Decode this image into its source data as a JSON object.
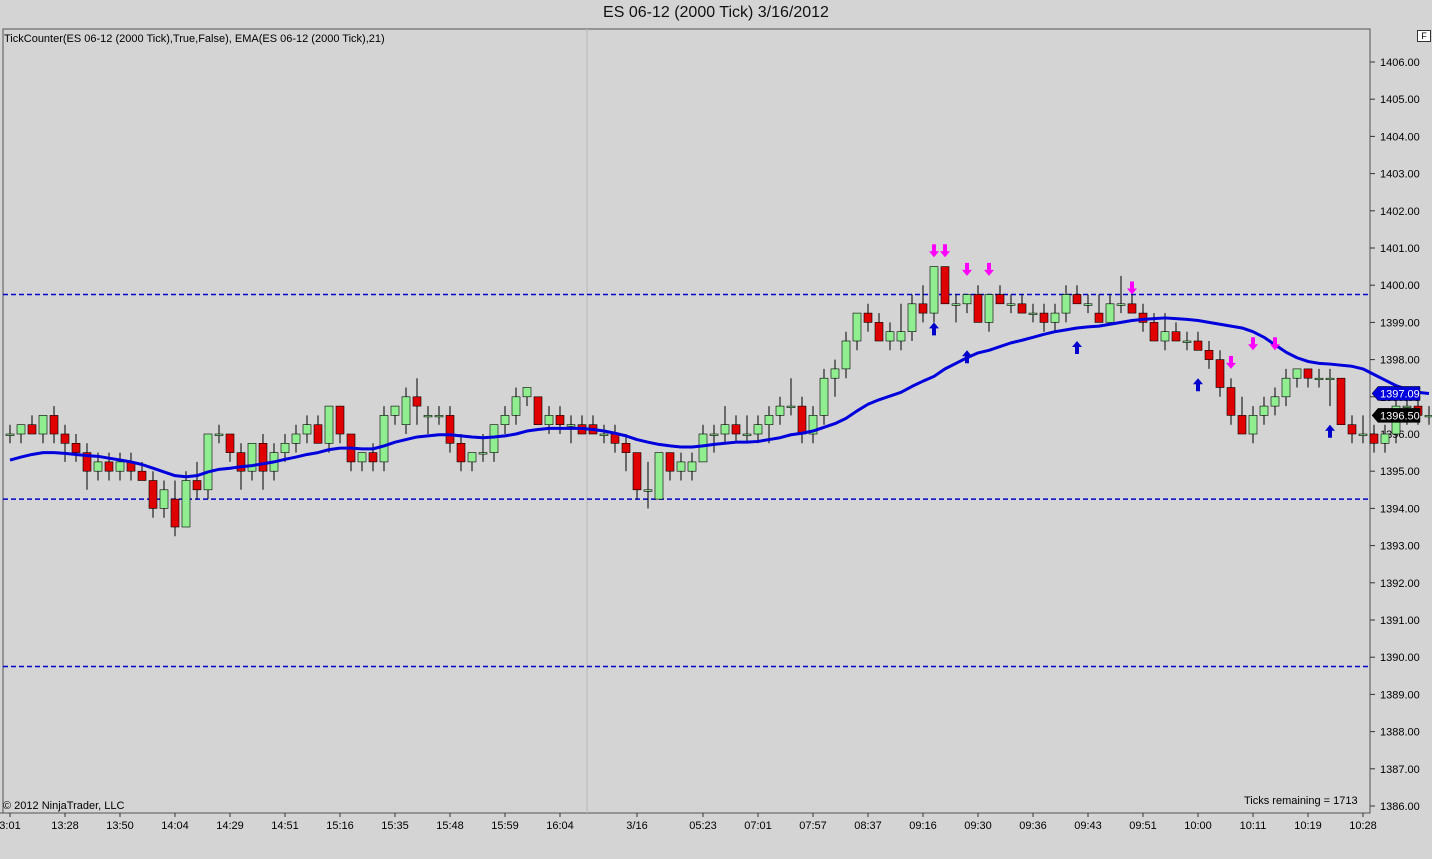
{
  "window": {
    "title": "ES 06-12 (2000 Tick)  3/16/2012"
  },
  "chart": {
    "indicator_label": "TickCounter(ES 06-12 (2000 Tick),True,False), EMA(ES 06-12 (2000 Tick),21)",
    "copyright": "© 2012 NinjaTrader, LLC",
    "ticks_remaining": "Ticks remaining = 1713",
    "f_button": "F",
    "colors": {
      "background": "#d4d4d4",
      "up": "#90ee90",
      "down": "#e00000",
      "ema": "#0000dd",
      "hline": "#0000cc",
      "long_arrow": "#0000cc",
      "short_arrow": "#ff00ff"
    }
  },
  "chart_data": {
    "type": "candlestick",
    "instrument": "ES 06-12",
    "bar_type": "2000 Tick",
    "date": "3/16/2012",
    "y_axis": {
      "min": 1386,
      "max": 1406.4,
      "tick_labels": [
        "1406.00",
        "1405.00",
        "1404.00",
        "1403.00",
        "1402.00",
        "1401.00",
        "1400.00",
        "1399.00",
        "1398.00",
        "1397.00",
        "1396.00",
        "1395.00",
        "1394.00",
        "1393.00",
        "1392.00",
        "1391.00",
        "1390.00",
        "1389.00",
        "1388.00",
        "1387.00",
        "1386.00"
      ]
    },
    "x_tick_labels": [
      {
        "bar": 0,
        "label": "3:01"
      },
      {
        "bar": 5,
        "label": "13:28"
      },
      {
        "bar": 10,
        "label": "13:50"
      },
      {
        "bar": 15,
        "label": "14:04"
      },
      {
        "bar": 20,
        "label": "14:29"
      },
      {
        "bar": 25,
        "label": "14:51"
      },
      {
        "bar": 30,
        "label": "15:16"
      },
      {
        "bar": 35,
        "label": "15:35"
      },
      {
        "bar": 40,
        "label": "15:48"
      },
      {
        "bar": 45,
        "label": "15:59"
      },
      {
        "bar": 50,
        "label": "16:04"
      },
      {
        "bar": 57,
        "label": "3/16"
      },
      {
        "bar": 63,
        "label": "05:23"
      },
      {
        "bar": 68,
        "label": "07:01"
      },
      {
        "bar": 73,
        "label": "07:57"
      },
      {
        "bar": 78,
        "label": "08:37"
      },
      {
        "bar": 83,
        "label": "09:16"
      },
      {
        "bar": 88,
        "label": "09:30"
      },
      {
        "bar": 93,
        "label": "09:36"
      },
      {
        "bar": 98,
        "label": "09:43"
      },
      {
        "bar": 103,
        "label": "09:51"
      },
      {
        "bar": 108,
        "label": "10:00"
      },
      {
        "bar": 113,
        "label": "10:11"
      },
      {
        "bar": 118,
        "label": "10:19"
      },
      {
        "bar": 123,
        "label": "10:28"
      }
    ],
    "session_break_after_bar": 52,
    "last_price_label": "1396.50",
    "last_price": 1396.5,
    "ema_label": "1397.09",
    "ema_last": 1397.09,
    "horizontal_lines": [
      1399.75,
      1394.25,
      1389.75
    ],
    "ohlc": [
      [
        1396,
        1396.25,
        1395.75,
        1396
      ],
      [
        1396,
        1396.25,
        1395.75,
        1396.25
      ],
      [
        1396.25,
        1396.5,
        1396,
        1396
      ],
      [
        1396,
        1396.5,
        1395.75,
        1396.5
      ],
      [
        1396.5,
        1396.75,
        1395.75,
        1396
      ],
      [
        1396,
        1396.25,
        1395.25,
        1395.75
      ],
      [
        1395.75,
        1396,
        1395.25,
        1395.5
      ],
      [
        1395.5,
        1395.75,
        1394.5,
        1395
      ],
      [
        1395,
        1395.5,
        1394.75,
        1395.25
      ],
      [
        1395.25,
        1395.5,
        1394.75,
        1395
      ],
      [
        1395,
        1395.5,
        1394.75,
        1395.25
      ],
      [
        1395.25,
        1395.5,
        1394.75,
        1395
      ],
      [
        1395,
        1395.25,
        1394.75,
        1394.75
      ],
      [
        1394.75,
        1395,
        1393.75,
        1394
      ],
      [
        1394,
        1394.75,
        1393.75,
        1394.5
      ],
      [
        1394.25,
        1394.75,
        1393.25,
        1393.5
      ],
      [
        1393.5,
        1395,
        1393.5,
        1394.75
      ],
      [
        1394.75,
        1395.25,
        1394.25,
        1394.5
      ],
      [
        1394.5,
        1396,
        1394.25,
        1396
      ],
      [
        1396,
        1396.25,
        1395.75,
        1396
      ],
      [
        1396,
        1396,
        1395.25,
        1395.5
      ],
      [
        1395.5,
        1395.75,
        1394.5,
        1395
      ],
      [
        1395,
        1395.75,
        1394.75,
        1395.75
      ],
      [
        1395.75,
        1396,
        1394.5,
        1395
      ],
      [
        1395,
        1395.75,
        1394.75,
        1395.5
      ],
      [
        1395.5,
        1396,
        1395.25,
        1395.75
      ],
      [
        1395.75,
        1396.25,
        1395.5,
        1396
      ],
      [
        1396,
        1396.5,
        1395.75,
        1396.25
      ],
      [
        1396.25,
        1396.5,
        1395.75,
        1395.75
      ],
      [
        1395.75,
        1396.75,
        1395.5,
        1396.75
      ],
      [
        1396.75,
        1396.75,
        1395.75,
        1396
      ],
      [
        1396,
        1396,
        1395,
        1395.25
      ],
      [
        1395.25,
        1395.5,
        1395,
        1395.5
      ],
      [
        1395.5,
        1395.75,
        1395,
        1395.25
      ],
      [
        1395.25,
        1396.75,
        1395,
        1396.5
      ],
      [
        1396.5,
        1396.75,
        1396.25,
        1396.75
      ],
      [
        1396.25,
        1397.25,
        1396,
        1397
      ],
      [
        1397,
        1397.5,
        1396.25,
        1396.75
      ],
      [
        1396.5,
        1396.75,
        1396,
        1396.5
      ],
      [
        1396.5,
        1396.75,
        1396.25,
        1396.5
      ],
      [
        1396.5,
        1396.75,
        1395.5,
        1395.75
      ],
      [
        1395.75,
        1396,
        1395,
        1395.25
      ],
      [
        1395.25,
        1395.5,
        1395,
        1395.5
      ],
      [
        1395.5,
        1396,
        1395.25,
        1395.5
      ],
      [
        1395.5,
        1396.25,
        1395.25,
        1396.25
      ],
      [
        1396.25,
        1396.75,
        1396,
        1396.5
      ],
      [
        1396.5,
        1397.25,
        1396.25,
        1397
      ],
      [
        1397,
        1397.25,
        1396.75,
        1397.25
      ],
      [
        1397,
        1397,
        1396.25,
        1396.25
      ],
      [
        1396.25,
        1396.75,
        1396,
        1396.5
      ],
      [
        1396.5,
        1396.75,
        1396,
        1396.25
      ],
      [
        1396.25,
        1396.5,
        1395.75,
        1396.25
      ],
      [
        1396.25,
        1396.5,
        1396,
        1396
      ],
      [
        1396.25,
        1396.5,
        1396,
        1396
      ],
      [
        1396,
        1396.25,
        1395.75,
        1396
      ],
      [
        1396,
        1396.25,
        1395.5,
        1395.75
      ],
      [
        1395.75,
        1396,
        1395,
        1395.5
      ],
      [
        1395.5,
        1395.5,
        1394.25,
        1394.5
      ],
      [
        1394.5,
        1395.25,
        1394,
        1394.5
      ],
      [
        1394.25,
        1395.5,
        1394.25,
        1395.5
      ],
      [
        1395.5,
        1395.5,
        1394.75,
        1395
      ],
      [
        1395,
        1395.5,
        1394.75,
        1395.25
      ],
      [
        1395,
        1395.5,
        1394.75,
        1395.25
      ],
      [
        1395.25,
        1396.25,
        1395.25,
        1396
      ],
      [
        1396,
        1396.25,
        1395.5,
        1396
      ],
      [
        1396,
        1396.75,
        1395.75,
        1396.25
      ],
      [
        1396.25,
        1396.5,
        1395.75,
        1396
      ],
      [
        1396,
        1396.5,
        1395.75,
        1396
      ],
      [
        1396,
        1396.5,
        1395.75,
        1396.25
      ],
      [
        1396.25,
        1396.75,
        1395.75,
        1396.5
      ],
      [
        1396.5,
        1397,
        1396.25,
        1396.75
      ],
      [
        1396.75,
        1397.5,
        1396.5,
        1396.75
      ],
      [
        1396.75,
        1397,
        1395.75,
        1396
      ],
      [
        1396,
        1396.75,
        1395.75,
        1396.5
      ],
      [
        1396.5,
        1397.75,
        1396.25,
        1397.5
      ],
      [
        1397.5,
        1398,
        1397,
        1397.75
      ],
      [
        1397.75,
        1398.75,
        1397.5,
        1398.5
      ],
      [
        1398.5,
        1399.25,
        1398.25,
        1399.25
      ],
      [
        1399.25,
        1399.5,
        1398.75,
        1399
      ],
      [
        1399,
        1399.25,
        1398.5,
        1398.5
      ],
      [
        1398.5,
        1399,
        1398.25,
        1398.75
      ],
      [
        1398.5,
        1399.5,
        1398.25,
        1398.75
      ],
      [
        1398.75,
        1399.75,
        1398.5,
        1399.5
      ],
      [
        1399.5,
        1400,
        1399,
        1399.25
      ],
      [
        1399.25,
        1400.5,
        1399,
        1400.5
      ],
      [
        1400.5,
        1400.5,
        1399.5,
        1399.5
      ],
      [
        1399.5,
        1399.75,
        1399,
        1399.5
      ],
      [
        1399.5,
        1399.75,
        1399.25,
        1399.75
      ],
      [
        1399.75,
        1400,
        1399,
        1399
      ],
      [
        1399,
        1399.75,
        1398.75,
        1399.75
      ],
      [
        1399.75,
        1400,
        1399.5,
        1399.5
      ],
      [
        1399.5,
        1399.75,
        1399.25,
        1399.5
      ],
      [
        1399.5,
        1399.75,
        1399.25,
        1399.25
      ],
      [
        1399.25,
        1399.5,
        1399,
        1399.25
      ],
      [
        1399.25,
        1399.5,
        1398.75,
        1399
      ],
      [
        1399,
        1399.5,
        1398.75,
        1399.25
      ],
      [
        1399.25,
        1400,
        1399,
        1399.75
      ],
      [
        1399.75,
        1400,
        1399.5,
        1399.5
      ],
      [
        1399.5,
        1399.75,
        1399.25,
        1399.5
      ],
      [
        1399.25,
        1399.75,
        1399,
        1399
      ],
      [
        1399,
        1399.75,
        1399,
        1399.5
      ],
      [
        1399.5,
        1400.25,
        1399.25,
        1399.5
      ],
      [
        1399.5,
        1399.75,
        1399.25,
        1399.25
      ],
      [
        1399.25,
        1399.5,
        1398.75,
        1399
      ],
      [
        1399,
        1399.25,
        1398.5,
        1398.5
      ],
      [
        1398.5,
        1399.25,
        1398.25,
        1398.75
      ],
      [
        1398.75,
        1399,
        1398.5,
        1398.5
      ],
      [
        1398.5,
        1398.75,
        1398.25,
        1398.5
      ],
      [
        1398.5,
        1398.75,
        1398.25,
        1398.25
      ],
      [
        1398.25,
        1398.5,
        1397.75,
        1398
      ],
      [
        1398,
        1398.25,
        1397,
        1397.25
      ],
      [
        1397.25,
        1397.5,
        1396.25,
        1396.5
      ],
      [
        1396.5,
        1397,
        1396,
        1396
      ],
      [
        1396,
        1396.75,
        1395.75,
        1396.5
      ],
      [
        1396.5,
        1397,
        1396.25,
        1396.75
      ],
      [
        1396.75,
        1397.25,
        1396.5,
        1397
      ],
      [
        1397,
        1397.75,
        1396.75,
        1397.5
      ],
      [
        1397.5,
        1397.75,
        1397.25,
        1397.75
      ],
      [
        1397.75,
        1397.75,
        1397.25,
        1397.5
      ],
      [
        1397.5,
        1397.75,
        1397.25,
        1397.5
      ],
      [
        1397.5,
        1397.75,
        1396.75,
        1397.5
      ],
      [
        1397.5,
        1397.5,
        1396.25,
        1396.25
      ],
      [
        1396.25,
        1396.5,
        1395.75,
        1396
      ],
      [
        1396,
        1396.5,
        1395.75,
        1396
      ],
      [
        1396,
        1396.25,
        1395.5,
        1395.75
      ],
      [
        1395.75,
        1396.25,
        1395.5,
        1396
      ],
      [
        1396,
        1397,
        1395.75,
        1396.75
      ],
      [
        1396.75,
        1397,
        1396.25,
        1396.75
      ],
      [
        1396.75,
        1397,
        1396.25,
        1396.5
      ],
      [
        1396.5,
        1396.75,
        1396.25,
        1396.5
      ]
    ],
    "ema": [
      1395.3,
      1395.38,
      1395.45,
      1395.5,
      1395.5,
      1395.48,
      1395.45,
      1395.42,
      1395.4,
      1395.35,
      1395.3,
      1395.25,
      1395.18,
      1395.08,
      1394.98,
      1394.88,
      1394.85,
      1394.88,
      1394.98,
      1395.05,
      1395.08,
      1395.12,
      1395.15,
      1395.2,
      1395.25,
      1395.32,
      1395.38,
      1395.45,
      1395.5,
      1395.58,
      1395.62,
      1395.62,
      1395.6,
      1395.6,
      1395.68,
      1395.78,
      1395.85,
      1395.92,
      1395.95,
      1395.98,
      1395.98,
      1395.95,
      1395.92,
      1395.9,
      1395.92,
      1395.95,
      1396,
      1396.08,
      1396.12,
      1396.15,
      1396.15,
      1396.15,
      1396.15,
      1396.12,
      1396.08,
      1396.02,
      1395.95,
      1395.85,
      1395.78,
      1395.72,
      1395.68,
      1395.65,
      1395.65,
      1395.68,
      1395.72,
      1395.75,
      1395.78,
      1395.78,
      1395.8,
      1395.85,
      1395.9,
      1395.98,
      1396.02,
      1396.08,
      1396.18,
      1396.28,
      1396.42,
      1396.62,
      1396.8,
      1396.92,
      1397.02,
      1397.12,
      1397.28,
      1397.42,
      1397.55,
      1397.75,
      1397.9,
      1398.05,
      1398.18,
      1398.25,
      1398.35,
      1398.45,
      1398.52,
      1398.6,
      1398.68,
      1398.75,
      1398.8,
      1398.85,
      1398.88,
      1398.9,
      1398.95,
      1399,
      1399.05,
      1399.08,
      1399.1,
      1399.12,
      1399.1,
      1399.08,
      1399.05,
      1399,
      1398.95,
      1398.9,
      1398.85,
      1398.75,
      1398.6,
      1398.4,
      1398.2,
      1398.05,
      1397.95,
      1397.9,
      1397.88,
      1397.85,
      1397.82,
      1397.75,
      1397.6,
      1397.45,
      1397.3,
      1397.2,
      1397.12,
      1397.09
    ],
    "long_signals": [
      {
        "bar": 84,
        "price": 1399.0
      },
      {
        "bar": 87,
        "price": 1398.25
      },
      {
        "bar": 97,
        "price": 1398.5
      },
      {
        "bar": 108,
        "price": 1397.5
      },
      {
        "bar": 120,
        "price": 1396.25
      }
    ],
    "short_signals": [
      {
        "bar": 84,
        "price": 1400.75
      },
      {
        "bar": 85,
        "price": 1400.75
      },
      {
        "bar": 87,
        "price": 1400.25
      },
      {
        "bar": 89,
        "price": 1400.25
      },
      {
        "bar": 102,
        "price": 1399.75
      },
      {
        "bar": 111,
        "price": 1397.75
      },
      {
        "bar": 113,
        "price": 1398.25
      },
      {
        "bar": 115,
        "price": 1398.25
      }
    ]
  }
}
